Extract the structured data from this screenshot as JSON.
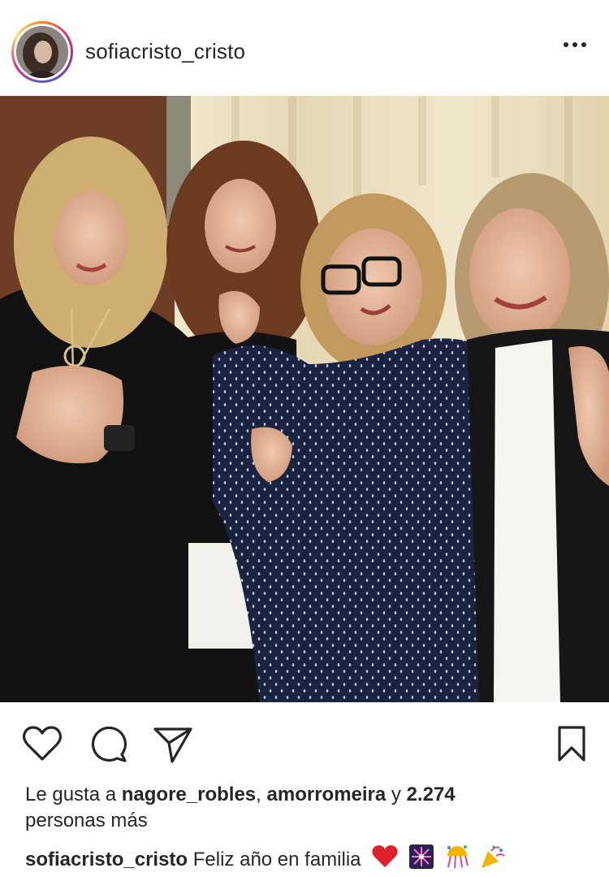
{
  "header": {
    "username": "sofiacristo_cristo",
    "more_icon": "ellipsis-icon"
  },
  "actions": {
    "like_icon": "heart-outline-icon",
    "comment_icon": "comment-bubble-icon",
    "share_icon": "paper-plane-icon",
    "save_icon": "bookmark-icon"
  },
  "likes": {
    "prefix": "Le gusta a",
    "user1": "nagore_robles",
    "separator": ",",
    "user2": "amorromeira",
    "and": "y",
    "count": "2.274",
    "suffix": "personas más"
  },
  "caption": {
    "username": "sofiacristo_cristo",
    "text": "Feliz año en familia",
    "emojis": [
      "red-heart-emoji",
      "fireworks-emoji",
      "confetti-ball-emoji",
      "party-popper-emoji"
    ]
  }
}
